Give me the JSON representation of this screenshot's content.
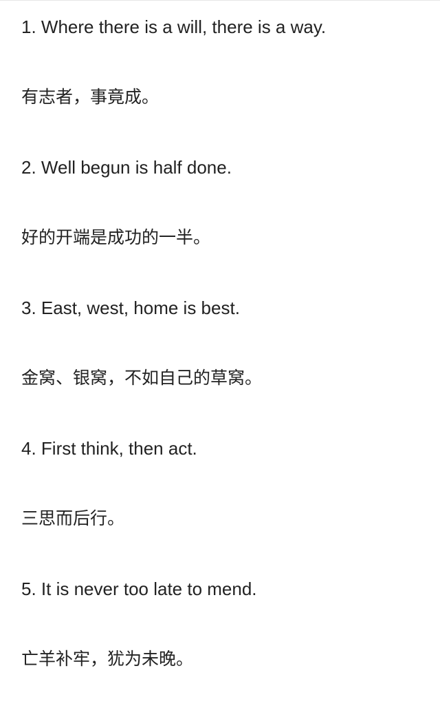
{
  "proverbs": [
    {
      "english": "1. Where there is a will, there is a way.",
      "chinese": "有志者，事竟成。"
    },
    {
      "english": "2. Well begun is half done.",
      "chinese": "好的开端是成功的一半。"
    },
    {
      "english": "3. East, west, home is best.",
      "chinese": "金窝、银窝，不如自己的草窝。"
    },
    {
      "english": "4. First think, then act.",
      "chinese": "三思而后行。"
    },
    {
      "english": "5. It is never too late to mend.",
      "chinese": "亡羊补牢，犹为未晚。"
    }
  ]
}
